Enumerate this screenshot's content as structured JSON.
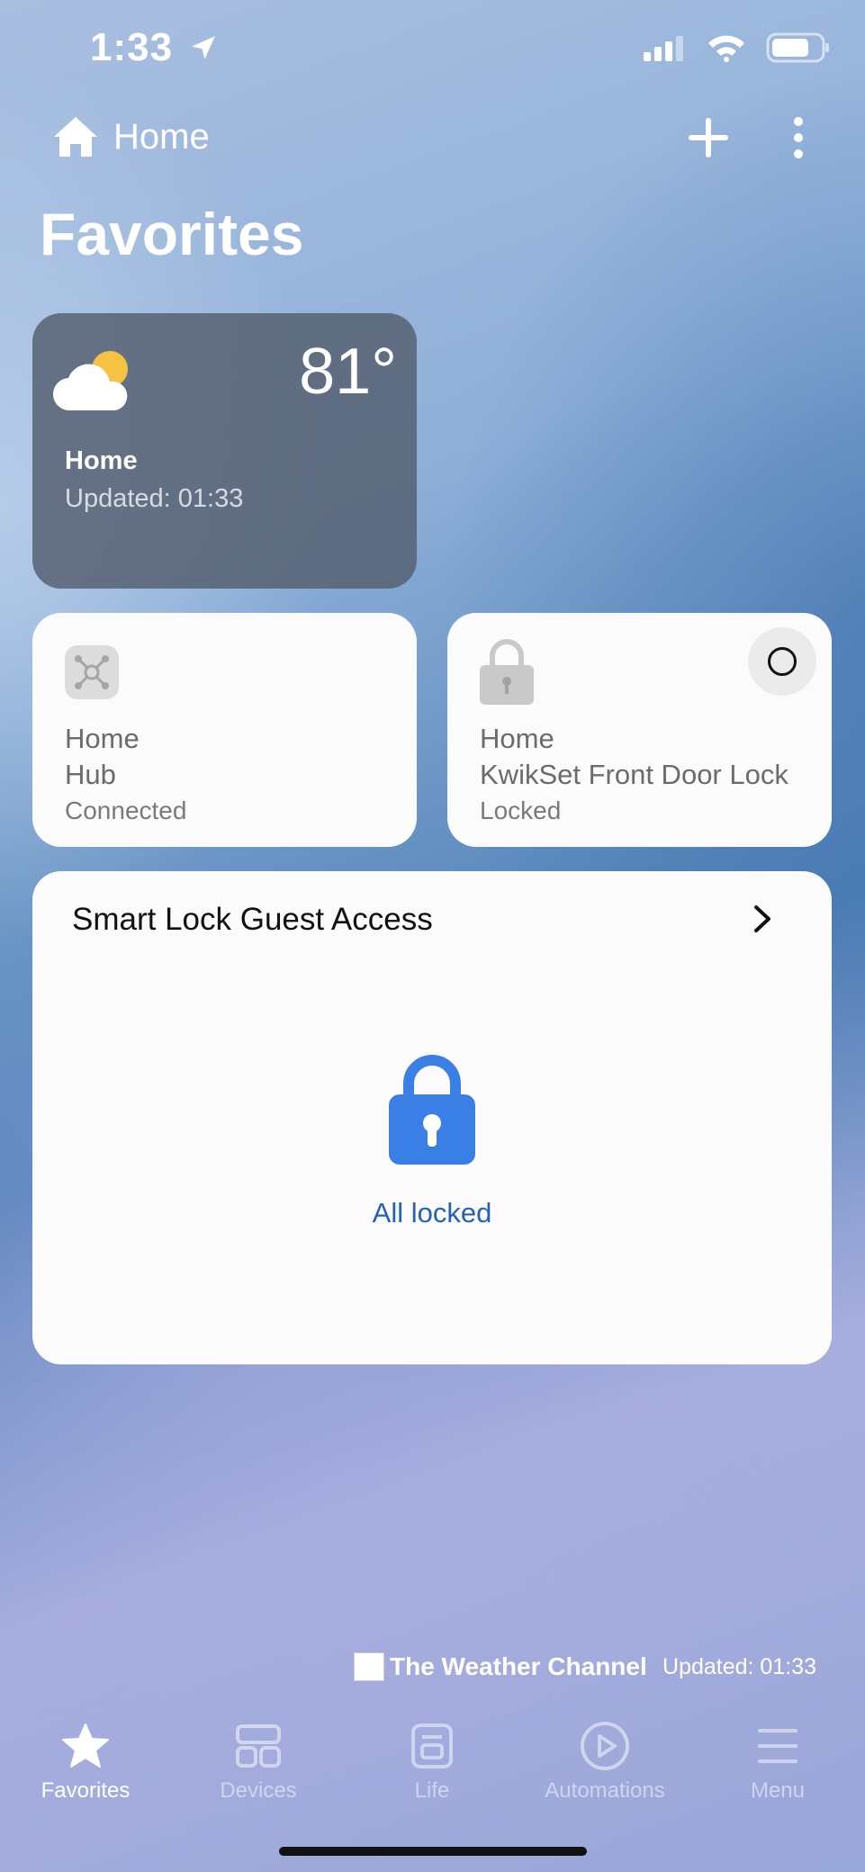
{
  "status_bar": {
    "time": "1:33"
  },
  "header": {
    "home_label": "Home"
  },
  "page_title": "Favorites",
  "weather_card": {
    "temperature": "81°",
    "location": "Home",
    "updated": "Updated: 01:33"
  },
  "hub_card": {
    "location": "Home",
    "name": "Hub",
    "status": "Connected"
  },
  "lock_card": {
    "location": "Home",
    "name": "KwikSet Front Door Lock",
    "status": "Locked"
  },
  "guest_access": {
    "title": "Smart Lock Guest Access",
    "status": "All locked"
  },
  "footer": {
    "brand": "The Weather Channel",
    "updated": "Updated: 01:33"
  },
  "tabs": [
    {
      "label": "Favorites",
      "icon": "star-icon",
      "active": true
    },
    {
      "label": "Devices",
      "icon": "devices-icon",
      "active": false
    },
    {
      "label": "Life",
      "icon": "life-icon",
      "active": false
    },
    {
      "label": "Automations",
      "icon": "play-icon",
      "active": false
    },
    {
      "label": "Menu",
      "icon": "menu-icon",
      "active": false
    }
  ],
  "colors": {
    "accent_blue": "#2561b8",
    "lock_blue": "#3a7fe6",
    "sun": "#f5c343"
  }
}
